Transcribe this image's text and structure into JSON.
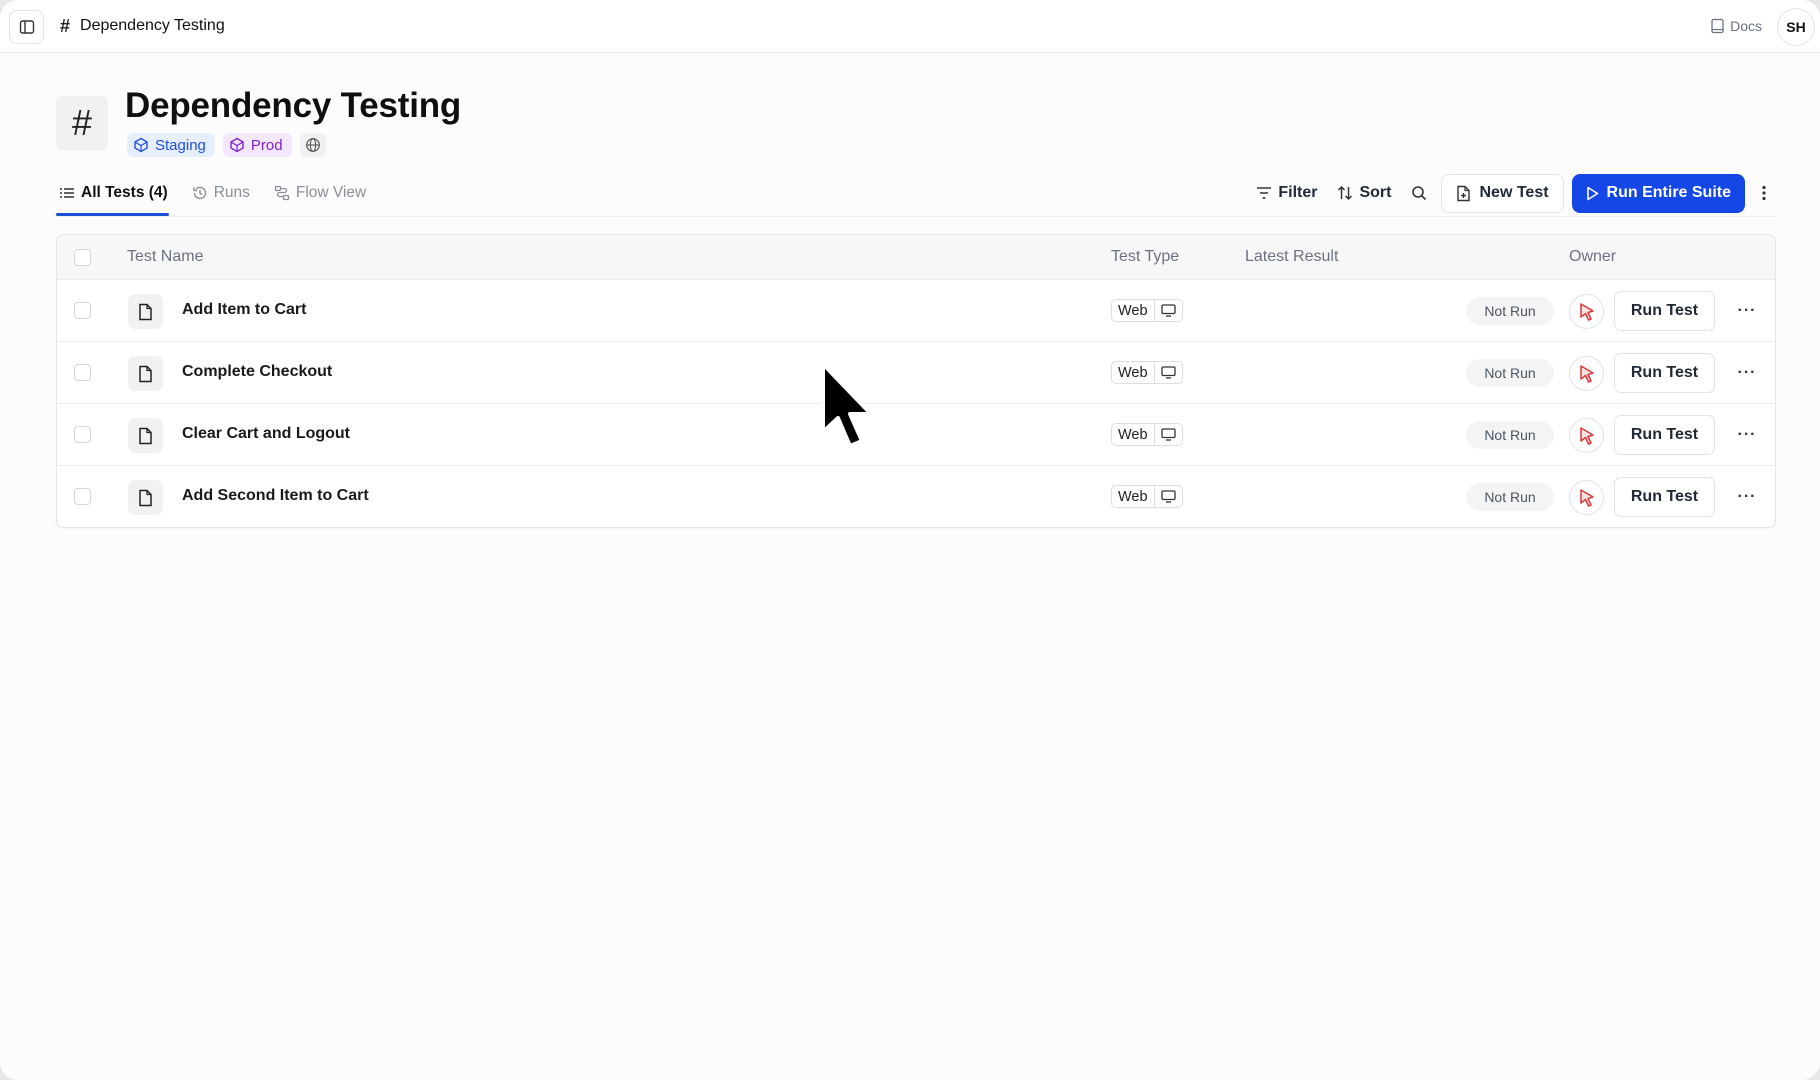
{
  "topbar": {
    "breadcrumb_title": "Dependency Testing",
    "docs_label": "Docs",
    "user_initials": "SH"
  },
  "header": {
    "title": "Dependency Testing",
    "environments": [
      {
        "label": "Staging",
        "color": "#1e4fd8"
      },
      {
        "label": "Prod",
        "color": "#7e22ce"
      }
    ]
  },
  "tabs": [
    {
      "label": "All Tests (4)",
      "icon": "list-icon",
      "active": true
    },
    {
      "label": "Runs",
      "icon": "history-icon",
      "active": false
    },
    {
      "label": "Flow View",
      "icon": "flow-icon",
      "active": false
    }
  ],
  "toolbar": {
    "filter_label": "Filter",
    "sort_label": "Sort",
    "new_test_label": "New Test",
    "run_suite_label": "Run Entire Suite",
    "accent_color": "#1447e6"
  },
  "table": {
    "columns": [
      "Test Name",
      "Test Type",
      "Latest Result",
      "Owner"
    ],
    "rows": [
      {
        "name": "Add Item to Cart",
        "type": "Web",
        "status": "Not Run",
        "action": "Run Test"
      },
      {
        "name": "Complete Checkout",
        "type": "Web",
        "status": "Not Run",
        "action": "Run Test"
      },
      {
        "name": "Clear Cart and Logout",
        "type": "Web",
        "status": "Not Run",
        "action": "Run Test"
      },
      {
        "name": "Add Second Item to Cart",
        "type": "Web",
        "status": "Not Run",
        "action": "Run Test"
      }
    ]
  }
}
